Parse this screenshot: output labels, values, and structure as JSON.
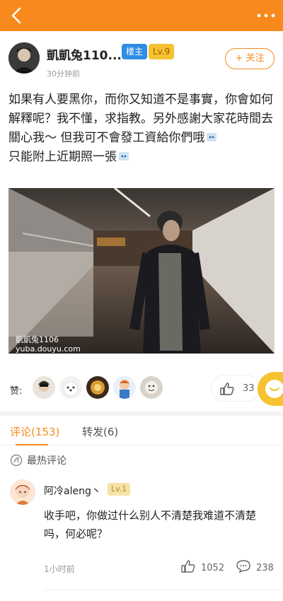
{
  "colors": {
    "accent": "#f7891d",
    "owner_badge": "#2f8de4",
    "level_badge": "#f6c22f"
  },
  "topbar": {
    "back_icon": "chevron-left-icon",
    "more_icon": "more-dots-icon"
  },
  "author": {
    "name": "凱凱兔110...",
    "owner_badge": "楼主",
    "level": "Lv.9",
    "time": "30分钟前",
    "follow_label": "+ 关注"
  },
  "post": {
    "line1": "如果有人要黑你，而你又知道不是事實，你會如何解釋呢？我不懂，求指教。另外感謝大家花時間去關心我～ 但我可不會發工資給你們哦",
    "line2": "只能附上近期照一張",
    "watermark_name": "凱凱兔1106",
    "watermark_site": "yuba.douyu.com"
  },
  "likes": {
    "label": "赞:",
    "count": "33"
  },
  "tabs": [
    {
      "label": "评论(153)"
    },
    {
      "label": "转发(6)"
    }
  ],
  "hot": {
    "label": "最热评论"
  },
  "comment": {
    "user": "阿冷aleng丶",
    "level": "Lv.1",
    "text": "收手吧，你做过什么别人不清楚我难道不清楚吗，何必呢？",
    "time": "1小时前",
    "likes": "1052",
    "replies": "238"
  }
}
